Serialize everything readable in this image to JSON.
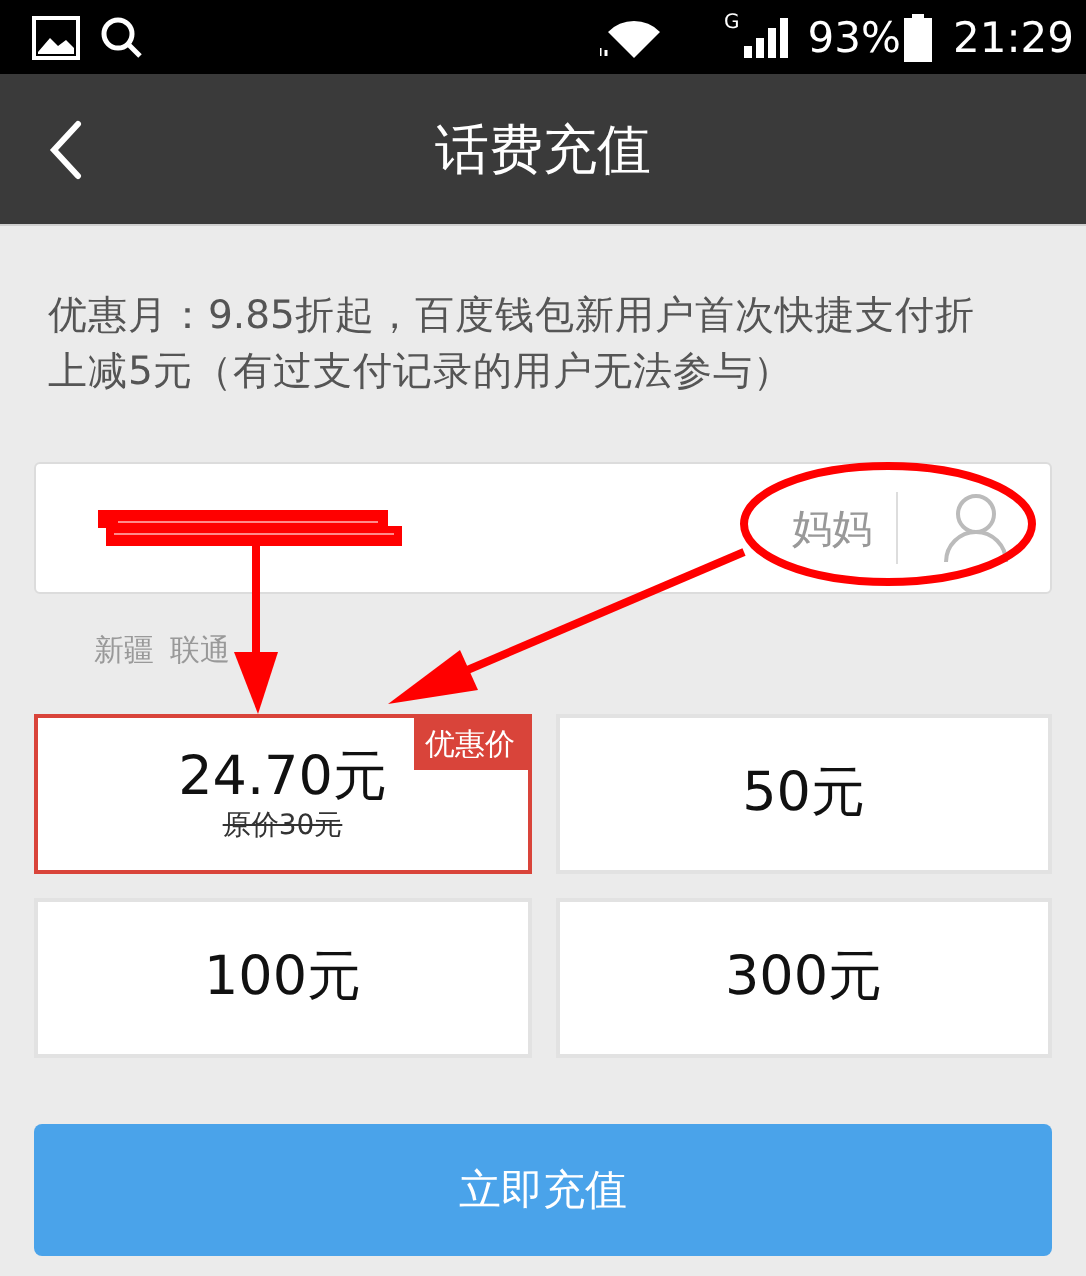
{
  "status_bar": {
    "network": "G",
    "battery": "93%",
    "time": "21:29"
  },
  "nav": {
    "title": "话费充值"
  },
  "notice_lines": [
    "优惠月：9.85折起，百度钱包新用户首次快捷支付折",
    "上减5元（有过支付记录的用户无法参与）"
  ],
  "phone_field": {
    "contact": "妈妈"
  },
  "carrier": [
    "新疆",
    "联通"
  ],
  "amounts": [
    {
      "label": "24.70元",
      "original": "原价30元",
      "badge": "优惠价",
      "selected": true
    },
    {
      "label": "50元",
      "selected": false
    },
    {
      "label": "100元",
      "selected": false
    },
    {
      "label": "300元",
      "selected": false
    }
  ],
  "submit": "立即充值"
}
